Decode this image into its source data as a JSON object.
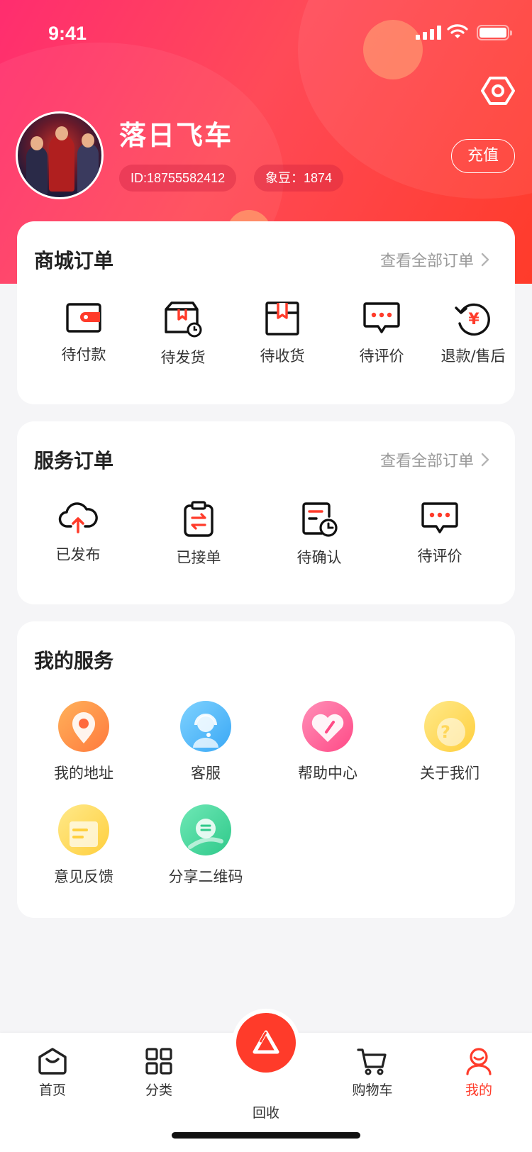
{
  "status_bar": {
    "time": "9:41"
  },
  "profile": {
    "username": "落日飞车",
    "id_text": "ID:18755582412",
    "beans_text": "象豆：1874",
    "recharge_label": "充值"
  },
  "mall_orders": {
    "title": "商城订单",
    "view_all": "查看全部订单",
    "items": [
      {
        "label": "待付款",
        "icon": "wallet-icon"
      },
      {
        "label": "待发货",
        "icon": "box-clock-icon"
      },
      {
        "label": "待收货",
        "icon": "package-icon"
      },
      {
        "label": "待评价",
        "icon": "comment-icon"
      },
      {
        "label": "退款/售后",
        "icon": "refund-icon"
      }
    ]
  },
  "service_orders": {
    "title": "服务订单",
    "view_all": "查看全部订单",
    "items": [
      {
        "label": "已发布",
        "icon": "cloud-upload-icon"
      },
      {
        "label": "已接单",
        "icon": "clipboard-exchange-icon"
      },
      {
        "label": "待确认",
        "icon": "document-clock-icon"
      },
      {
        "label": "待评价",
        "icon": "comment-icon"
      }
    ]
  },
  "my_services": {
    "title": "我的服务",
    "items": [
      {
        "label": "我的地址",
        "icon": "location-icon"
      },
      {
        "label": "客服",
        "icon": "headset-icon"
      },
      {
        "label": "帮助中心",
        "icon": "heart-icon"
      },
      {
        "label": "关于我们",
        "icon": "question-icon"
      },
      {
        "label": "意见反馈",
        "icon": "note-icon"
      },
      {
        "label": "分享二维码",
        "icon": "share-icon"
      }
    ]
  },
  "tabbar": {
    "items": [
      {
        "label": "首页",
        "icon": "home-icon"
      },
      {
        "label": "分类",
        "icon": "grid-icon"
      },
      {
        "label": "回收",
        "icon": "recycle-icon"
      },
      {
        "label": "购物车",
        "icon": "cart-icon"
      },
      {
        "label": "我的",
        "icon": "person-icon",
        "active": true
      }
    ]
  },
  "colors": {
    "accent": "#ff3b2a",
    "hero_start": "#ff2d6f",
    "hero_end": "#ff3b2a"
  }
}
